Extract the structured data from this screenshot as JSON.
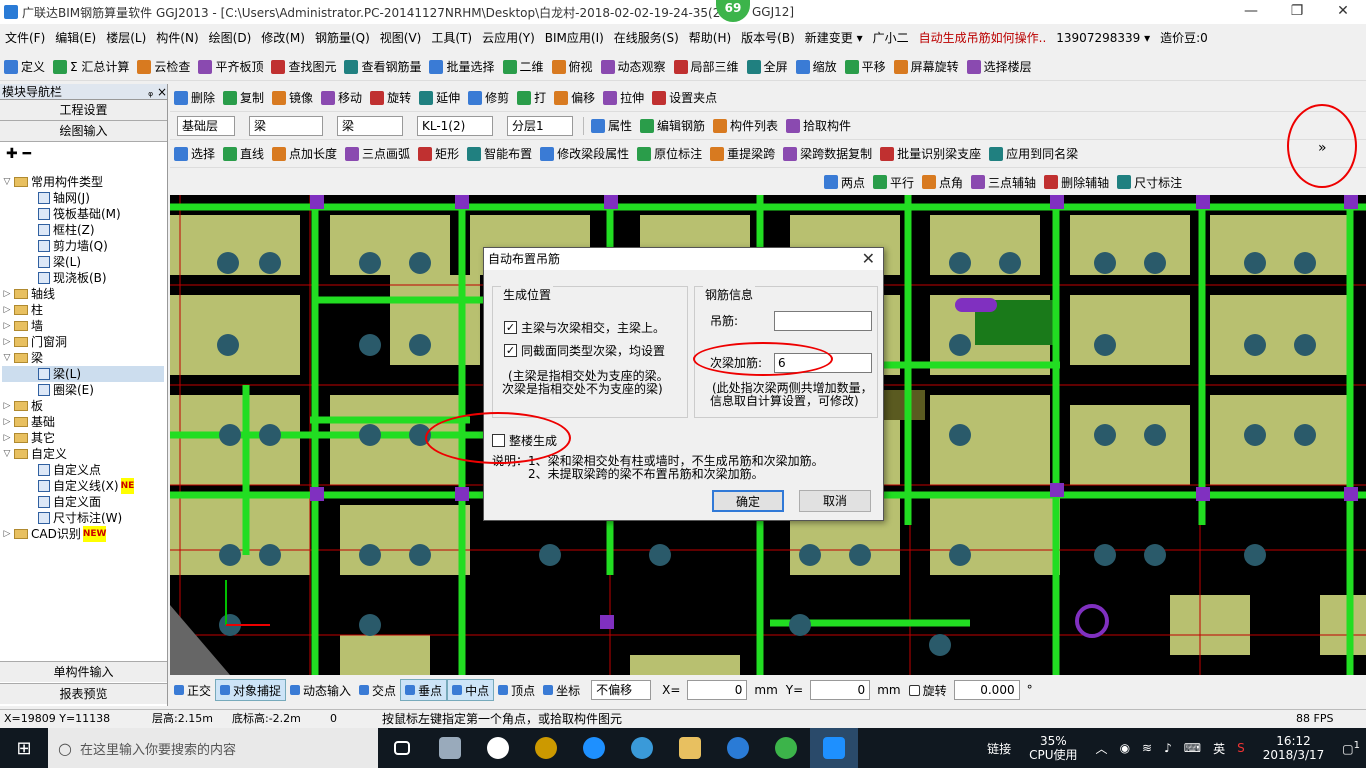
{
  "window": {
    "title": "广联达BIM钢筋算量软件 GGJ2013 - [C:\\Users\\Administrator.PC-20141127NRHM\\Desktop\\白龙村-2018-02-02-19-24-35(2",
    "title_tail": "GGJ12]",
    "badge": "69",
    "min": "—",
    "max": "❐",
    "close": "✕"
  },
  "menu": [
    "文件(F)",
    "编辑(E)",
    "楼层(L)",
    "构件(N)",
    "绘图(D)",
    "修改(M)",
    "钢筋量(Q)",
    "视图(V)",
    "工具(T)",
    "云应用(Y)",
    "BIM应用(I)",
    "在线服务(S)",
    "帮助(H)",
    "版本号(B)",
    "新建变更 ▾",
    "广小二",
    "自动生成吊筋如何操作..",
    "13907298339 ▾",
    "造价豆:0"
  ],
  "toolbar1": [
    "定义",
    "Σ 汇总计算",
    "云检查",
    "平齐板顶",
    "查找图元",
    "查看钢筋量",
    "批量选择",
    "二维",
    "俯视",
    "动态观察",
    "局部三维",
    "全屏",
    "缩放",
    "平移",
    "屏幕旋转",
    "选择楼层"
  ],
  "toolbar2": [
    "删除",
    "复制",
    "镜像",
    "移动",
    "旋转",
    "延伸",
    "修剪",
    "打",
    "偏移",
    "拉伸",
    "设置夹点"
  ],
  "toolbar3": {
    "floor": "基础层",
    "type1": "梁",
    "type2": "梁",
    "name": "KL-1(2)",
    "layer": "分层1",
    "items": [
      "属性",
      "编辑钢筋",
      "构件列表",
      "拾取构件"
    ]
  },
  "toolbar4": [
    "选择",
    "直线",
    "点加长度",
    "三点画弧",
    "矩形",
    "智能布置",
    "修改梁段属性",
    "原位标注",
    "重提梁跨",
    "梁跨数据复制",
    "批量识别梁支座",
    "应用到同名梁"
  ],
  "toolbar5": [
    "两点",
    "平行",
    "点角",
    "三点辅轴",
    "删除辅轴",
    "尺寸标注"
  ],
  "nav": {
    "header": "模块导航栏",
    "pin": "ᵩ ×",
    "btn1": "工程设置",
    "btn2": "绘图输入",
    "bottom1": "单构件输入",
    "bottom2": "报表预览"
  },
  "tree": [
    {
      "t": "常用构件类型",
      "lvl": 0,
      "exp": "▽",
      "f": true
    },
    {
      "t": "轴网(J)",
      "lvl": 2
    },
    {
      "t": "筏板基础(M)",
      "lvl": 2
    },
    {
      "t": "框柱(Z)",
      "lvl": 2
    },
    {
      "t": "剪力墙(Q)",
      "lvl": 2
    },
    {
      "t": "梁(L)",
      "lvl": 2
    },
    {
      "t": "现浇板(B)",
      "lvl": 2
    },
    {
      "t": "轴线",
      "lvl": 0,
      "exp": "▷",
      "f": true
    },
    {
      "t": "柱",
      "lvl": 0,
      "exp": "▷",
      "f": true
    },
    {
      "t": "墙",
      "lvl": 0,
      "exp": "▷",
      "f": true
    },
    {
      "t": "门窗洞",
      "lvl": 0,
      "exp": "▷",
      "f": true
    },
    {
      "t": "梁",
      "lvl": 0,
      "exp": "▽",
      "f": true
    },
    {
      "t": "梁(L)",
      "lvl": 2,
      "sel": true
    },
    {
      "t": "圈梁(E)",
      "lvl": 2
    },
    {
      "t": "板",
      "lvl": 0,
      "exp": "▷",
      "f": true
    },
    {
      "t": "基础",
      "lvl": 0,
      "exp": "▷",
      "f": true
    },
    {
      "t": "其它",
      "lvl": 0,
      "exp": "▷",
      "f": true
    },
    {
      "t": "自定义",
      "lvl": 0,
      "exp": "▽",
      "f": true
    },
    {
      "t": "自定义点",
      "lvl": 2
    },
    {
      "t": "自定义线(X)",
      "lvl": 2,
      "new": "NE"
    },
    {
      "t": "自定义面",
      "lvl": 2
    },
    {
      "t": "尺寸标注(W)",
      "lvl": 2
    },
    {
      "t": "CAD识别",
      "lvl": 0,
      "exp": "▷",
      "f": true,
      "new": "NEW"
    }
  ],
  "dialog": {
    "title": "自动布置吊筋",
    "close": "✕",
    "group1": "生成位置",
    "cb1": "主梁与次梁相交，主梁上。",
    "cb2": "同截面同类型次梁，均设置",
    "note1a": "(主梁是指相交处为支座的梁。",
    "note1b": "次梁是指相交处不为支座的梁)",
    "group2": "钢筋信息",
    "label_hanger": "吊筋:",
    "hanger_value": "",
    "label_extra": "次梁加筋:",
    "extra_value": "6",
    "note2a": "(此处指次梁两侧共增加数量，",
    "note2b": "信息取自计算设置，可修改)",
    "cb3": "整楼生成",
    "explain1": "说明：1、梁和梁相交处有柱或墙时，不生成吊筋和次梁加筋。",
    "explain2": "2、未提取梁跨的梁不布置吊筋和次梁加筋。",
    "ok": "确定",
    "cancel": "取消"
  },
  "snapbar": {
    "items": [
      "正交",
      "对象捕捉",
      "动态输入",
      "交点",
      "垂点",
      "中点",
      "顶点",
      "坐标"
    ],
    "offset": "不偏移",
    "xlabel": "X=",
    "x": "0",
    "ylabel": "Y=",
    "y": "0",
    "unit": "mm",
    "rotate": "旋转",
    "rot_val": "0.000",
    "deg": "°"
  },
  "status": {
    "coords": "X=19809 Y=11138",
    "floor_h": "层高:2.15m",
    "bottom_h": "底标高:-2.2m",
    "zero": "0",
    "hint": "按鼠标左键指定第一个角点，或拾取构件图元",
    "fps": "88 FPS"
  },
  "taskbar": {
    "search": "在这里输入你要搜索的内容",
    "link": "链接",
    "cpu": "35%",
    "cpu_label": "CPU使用",
    "ime": "英",
    "time": "16:12",
    "date": "2018/3/17",
    "notif": "1"
  },
  "colors": {
    "beam": "#22dd22",
    "slab": "#b8c070",
    "column": "#2a5a6a",
    "purple": "#8030c0",
    "red_line": "#c00000"
  }
}
